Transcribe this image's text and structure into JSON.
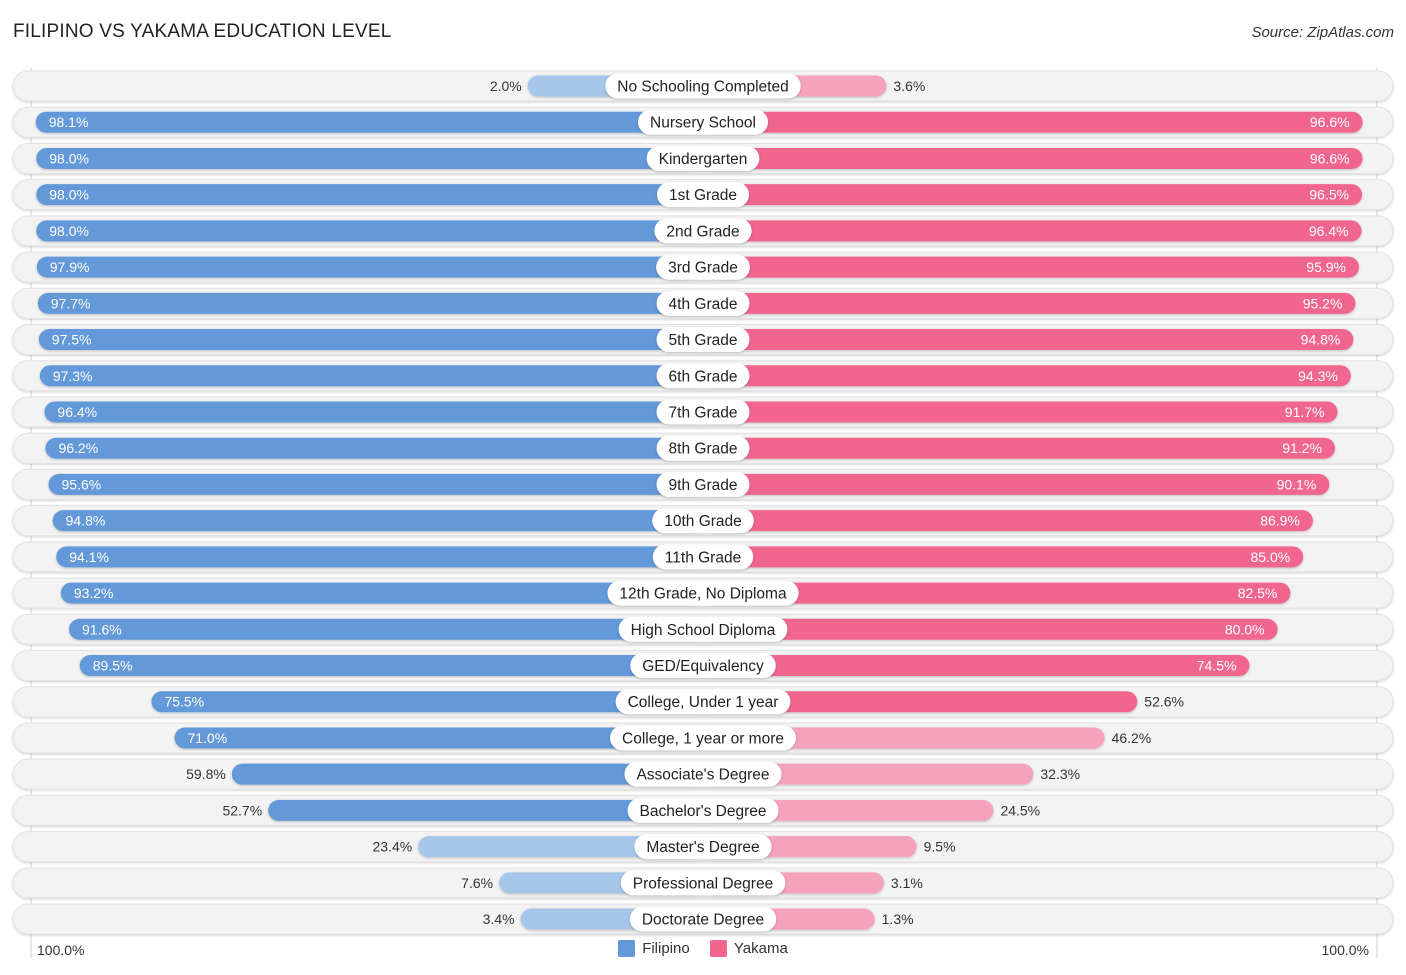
{
  "header": {
    "title": "FILIPINO VS YAKAMA EDUCATION LEVEL",
    "source": "Source: ZipAtlas.com"
  },
  "colors": {
    "filipino": "#6399d9",
    "filipino_light": "#a6c6ea",
    "yakama": "#f0668f",
    "yakama_light": "#f5a3bc",
    "track": "#f3f3f3"
  },
  "legend": [
    {
      "name": "Filipino",
      "color": "#6399d9"
    },
    {
      "name": "Yakama",
      "color": "#f0668f"
    }
  ],
  "axis": {
    "left_label": "100.0%",
    "right_label": "100.0%"
  },
  "chart_data": {
    "type": "bar",
    "orientation": "horizontal-diverging",
    "title": "FILIPINO VS YAKAMA EDUCATION LEVEL",
    "xlabel": "",
    "ylabel": "",
    "xlim": [
      0,
      100
    ],
    "legend_position": "bottom-center",
    "categories": [
      "No Schooling Completed",
      "Nursery School",
      "Kindergarten",
      "1st Grade",
      "2nd Grade",
      "3rd Grade",
      "4th Grade",
      "5th Grade",
      "6th Grade",
      "7th Grade",
      "8th Grade",
      "9th Grade",
      "10th Grade",
      "11th Grade",
      "12th Grade, No Diploma",
      "High School Diploma",
      "GED/Equivalency",
      "College, Under 1 year",
      "College, 1 year or more",
      "Associate's Degree",
      "Bachelor's Degree",
      "Master's Degree",
      "Professional Degree",
      "Doctorate Degree"
    ],
    "series": [
      {
        "name": "Filipino",
        "side": "left",
        "values": [
          2.0,
          98.1,
          98.0,
          98.0,
          98.0,
          97.9,
          97.7,
          97.5,
          97.3,
          96.4,
          96.2,
          95.6,
          94.8,
          94.1,
          93.2,
          91.6,
          89.5,
          75.5,
          71.0,
          59.8,
          52.7,
          23.4,
          7.6,
          3.4
        ],
        "labels": [
          "2.0%",
          "98.1%",
          "98.0%",
          "98.0%",
          "98.0%",
          "97.9%",
          "97.7%",
          "97.5%",
          "97.3%",
          "96.4%",
          "96.2%",
          "95.6%",
          "94.8%",
          "94.1%",
          "93.2%",
          "91.6%",
          "89.5%",
          "75.5%",
          "71.0%",
          "59.8%",
          "52.7%",
          "23.4%",
          "7.6%",
          "3.4%"
        ]
      },
      {
        "name": "Yakama",
        "side": "right",
        "values": [
          3.6,
          96.6,
          96.6,
          96.5,
          96.4,
          95.9,
          95.2,
          94.8,
          94.3,
          91.7,
          91.2,
          90.1,
          86.9,
          85.0,
          82.5,
          80.0,
          74.5,
          52.6,
          46.2,
          32.3,
          24.5,
          9.5,
          3.1,
          1.3
        ],
        "labels": [
          "3.6%",
          "96.6%",
          "96.6%",
          "96.5%",
          "96.4%",
          "95.9%",
          "95.2%",
          "94.8%",
          "94.3%",
          "91.7%",
          "91.2%",
          "90.1%",
          "86.9%",
          "85.0%",
          "82.5%",
          "80.0%",
          "74.5%",
          "52.6%",
          "46.2%",
          "32.3%",
          "24.5%",
          "9.5%",
          "3.1%",
          "1.3%"
        ]
      }
    ]
  }
}
